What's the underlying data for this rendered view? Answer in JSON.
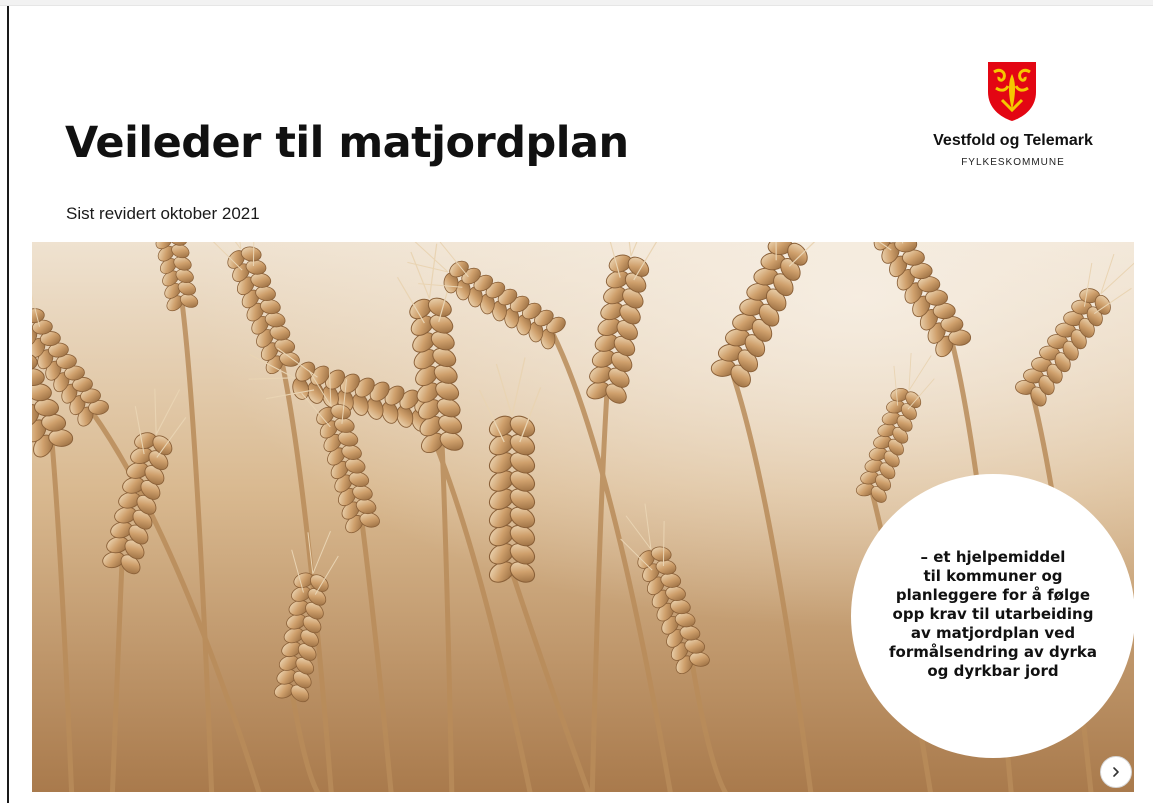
{
  "document": {
    "title": "Veileder til matjordplan",
    "subtitle": "Sist revidert oktober 2021"
  },
  "logo": {
    "name": "Vestfold og Telemark",
    "sub": "FYLKESKOMMUNE",
    "shield_colors": {
      "field": "#e30613",
      "charge": "#f6c800"
    }
  },
  "hero": {
    "image": "wheat-field-photo",
    "tagline": "– et hjelpemiddel\ntil kommuner og\nplanleggere for å følge\nopp krav til utarbeiding\nav matjordplan ved\nformålsendring av dyrka\nog dyrkbar jord"
  },
  "navigation": {
    "next_icon": "chevron-right-icon"
  },
  "colors": {
    "text": "#111111",
    "wheat_light": "#e8d3b3",
    "wheat_dark": "#9b6f42"
  }
}
